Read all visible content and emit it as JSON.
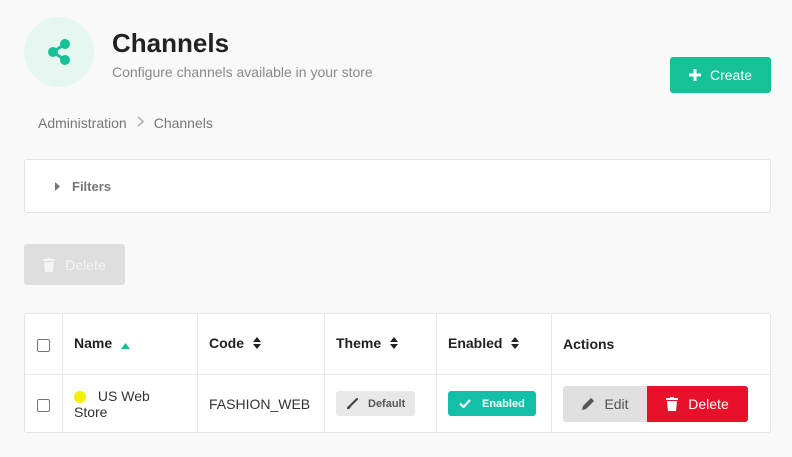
{
  "header": {
    "title": "Channels",
    "subtitle": "Configure channels available in your store",
    "create_label": "Create"
  },
  "breadcrumb": {
    "items": [
      "Administration",
      "Channels"
    ]
  },
  "filters": {
    "label": "Filters"
  },
  "bulk": {
    "delete_label": "Delete"
  },
  "table": {
    "columns": [
      "Name",
      "Code",
      "Theme",
      "Enabled",
      "Actions"
    ],
    "rows": [
      {
        "name": "US Web Store",
        "color": "#f0f000",
        "code": "FASHION_WEB",
        "theme": "Default",
        "enabled": "Enabled",
        "edit_label": "Edit",
        "delete_label": "Delete"
      }
    ]
  },
  "colors": {
    "accent": "#16c196",
    "danger": "#e8102b",
    "enabled": "#14bfa8"
  }
}
